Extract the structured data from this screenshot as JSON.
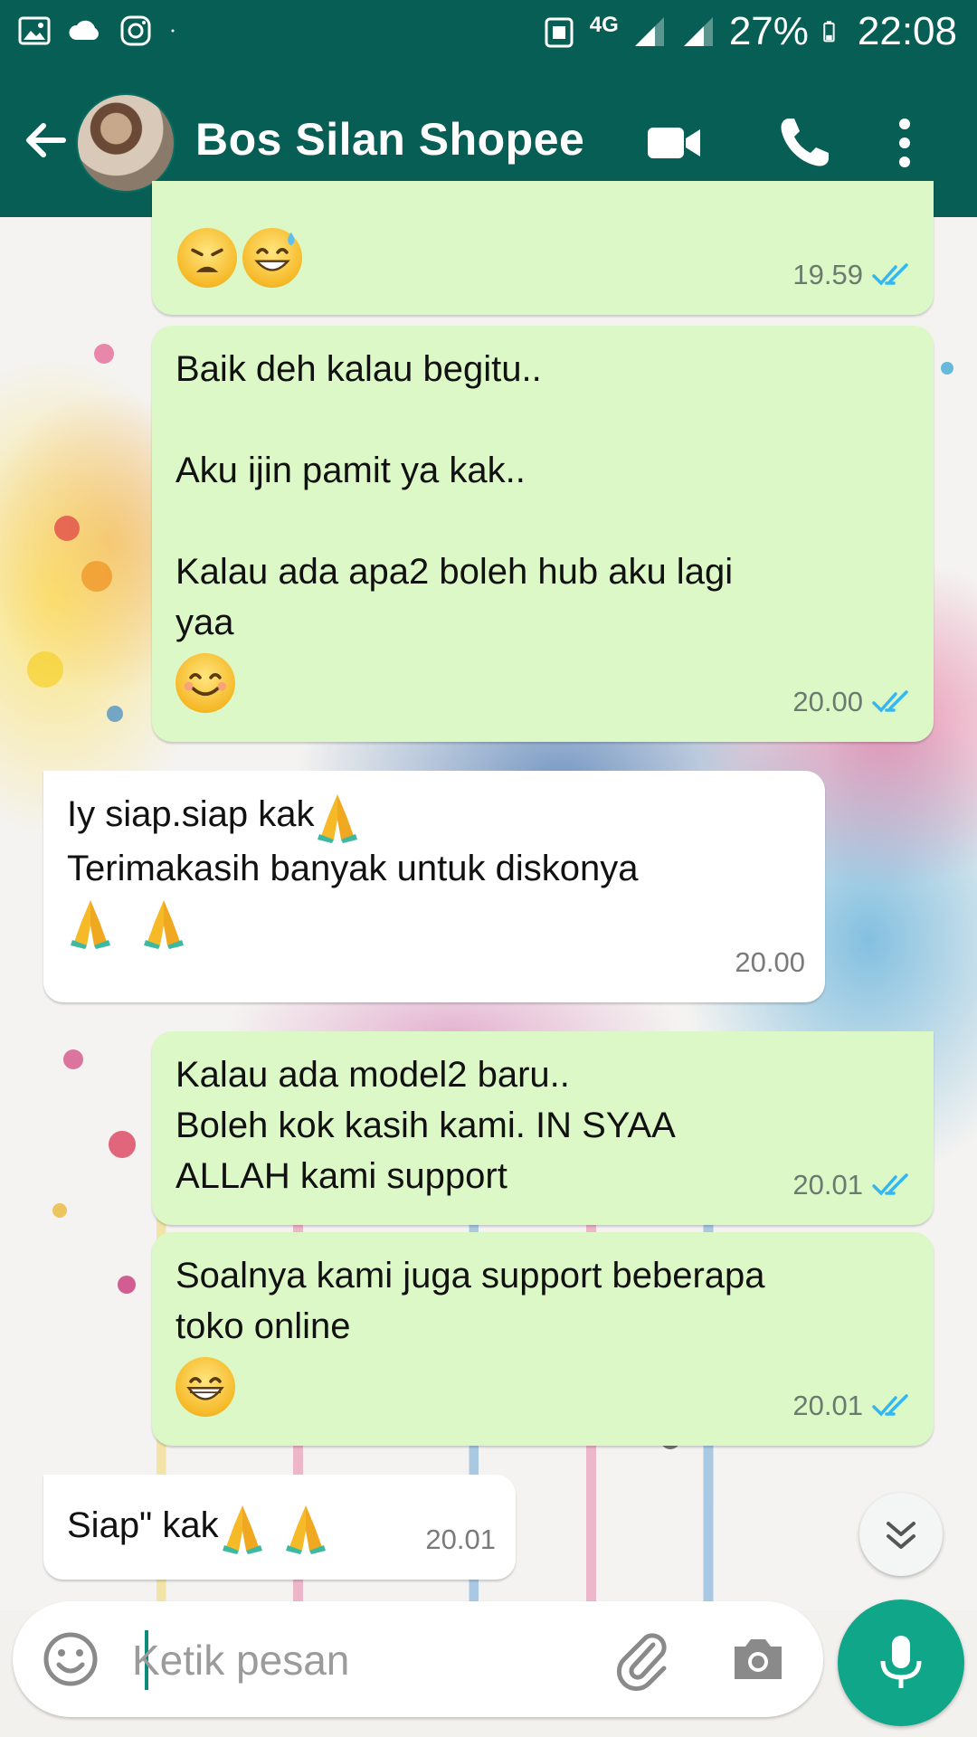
{
  "status_bar": {
    "network": "4G",
    "battery": "27%",
    "time": "22:08"
  },
  "header": {
    "contact_name": "Bos Silan Shopee"
  },
  "messages": [
    {
      "dir": "out",
      "text": "",
      "time": "19.59"
    },
    {
      "dir": "out",
      "text": "Baik deh kalau begitu..\n\nAku ijin pamit ya kak..\n\nKalau ada apa2 boleh hub aku lagi\nyaa",
      "time": "20.00"
    },
    {
      "dir": "in",
      "text": "Iy siap.siap kak",
      "text2": "Terimakasih banyak untuk diskonya",
      "time": "20.00"
    },
    {
      "dir": "out",
      "text": "Kalau ada model2 baru..\nBoleh kok kasih kami. IN SYAA\nALLAH kami support",
      "time": "20.01"
    },
    {
      "dir": "out",
      "text": "Soalnya kami juga support beberapa\ntoko online",
      "time": "20.01"
    },
    {
      "dir": "in",
      "text": "Siap\" kak",
      "time": "20.01"
    }
  ],
  "input": {
    "placeholder": "Ketik pesan"
  },
  "colors": {
    "header": "#075e54",
    "outgoing_bubble": "#dcf8c6",
    "incoming_bubble": "#ffffff",
    "read_ticks": "#34b7f1",
    "mic_button": "#0fa68a"
  }
}
